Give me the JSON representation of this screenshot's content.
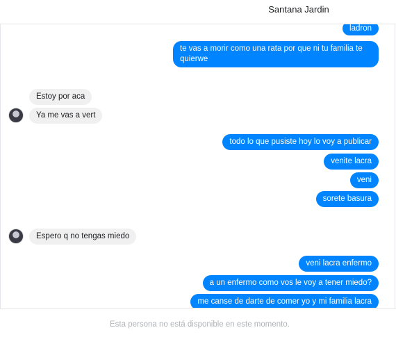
{
  "header": {
    "contact_name": "Santana Jardin"
  },
  "messages": [
    {
      "side": "out",
      "text": "ladron"
    },
    {
      "side": "out",
      "text": "te vas a morir como una rata por que ni tu familia te quierwe"
    },
    {
      "side": "in",
      "text": "Estoy por aca"
    },
    {
      "side": "in",
      "text": "Ya me vas a vert"
    },
    {
      "side": "out",
      "text": "todo lo que pusiste hoy lo voy a publicar"
    },
    {
      "side": "out",
      "text": "venite lacra"
    },
    {
      "side": "out",
      "text": "veni"
    },
    {
      "side": "out",
      "text": "sorete basura"
    },
    {
      "side": "in",
      "text": "Espero q no tengas miedo"
    },
    {
      "side": "out",
      "text": "veni lacra enfermo"
    },
    {
      "side": "out",
      "text": "a un enfermo como vos le voy a tener miedo?"
    },
    {
      "side": "out",
      "text": "me canse de darte de comer yo y mi familia lacra"
    }
  ],
  "footer": {
    "status_text": "Esta persona no está disponible en este momento."
  },
  "colors": {
    "outgoing_bubble": "#0084ff",
    "incoming_bubble": "#f1f0f0"
  }
}
